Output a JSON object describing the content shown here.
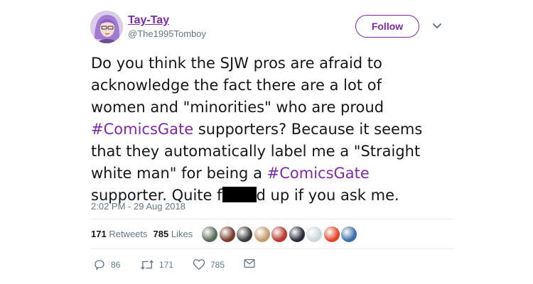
{
  "user": {
    "display_name": "Tay-Tay",
    "handle": "@The1995Tomboy"
  },
  "follow_label": "Follow",
  "tweet": {
    "lines": [
      [
        {
          "t": "Do you think the SJW pros are afraid to"
        }
      ],
      [
        {
          "t": "acknowledge the fact there are a lot of"
        }
      ],
      [
        {
          "t": "women and \"minorities\" who are proud"
        }
      ],
      [
        {
          "t": "#ComicsGate",
          "hashtag": true
        },
        {
          "t": " supporters? Because it seems"
        }
      ],
      [
        {
          "t": "that they automatically label me a \"Straight"
        }
      ],
      [
        {
          "t": "white man\" for being a "
        },
        {
          "t": "#ComicsGate",
          "hashtag": true
        }
      ],
      [
        {
          "t": "supporter. Quite f"
        },
        {
          "redacted": true
        },
        {
          "t": "d up if you ask me."
        }
      ]
    ]
  },
  "timestamp": "2:02 PM - 29 Aug 2018",
  "stats": {
    "retweets_count": "171",
    "retweets_label": "Retweets",
    "likes_count": "785",
    "likes_label": "Likes"
  },
  "likers": [
    {
      "color": "#5a6b5a",
      "label": "liker-avatar-1"
    },
    {
      "color": "#7a3b2a",
      "label": "liker-avatar-2"
    },
    {
      "color": "#3a3a3a",
      "label": "liker-avatar-3"
    },
    {
      "color": "#c49a6c",
      "label": "liker-avatar-4"
    },
    {
      "color": "#b8352c",
      "label": "liker-avatar-5"
    },
    {
      "color": "#2a2a3a",
      "label": "liker-avatar-6"
    },
    {
      "color": "#ccd6dd",
      "label": "liker-avatar-7"
    },
    {
      "color": "#e0452a",
      "label": "liker-avatar-8"
    },
    {
      "color": "#3b6ea8",
      "label": "liker-avatar-9"
    }
  ],
  "actions": {
    "reply_count": "86",
    "retweet_count": "171",
    "like_count": "785"
  },
  "colors": {
    "accent": "#7e2aa8",
    "text": "#14171a",
    "muted": "#657786",
    "divider": "#e6ecf0"
  },
  "icons": [
    "reply-icon",
    "retweet-icon",
    "heart-icon",
    "envelope-icon",
    "chevron-down-icon"
  ]
}
